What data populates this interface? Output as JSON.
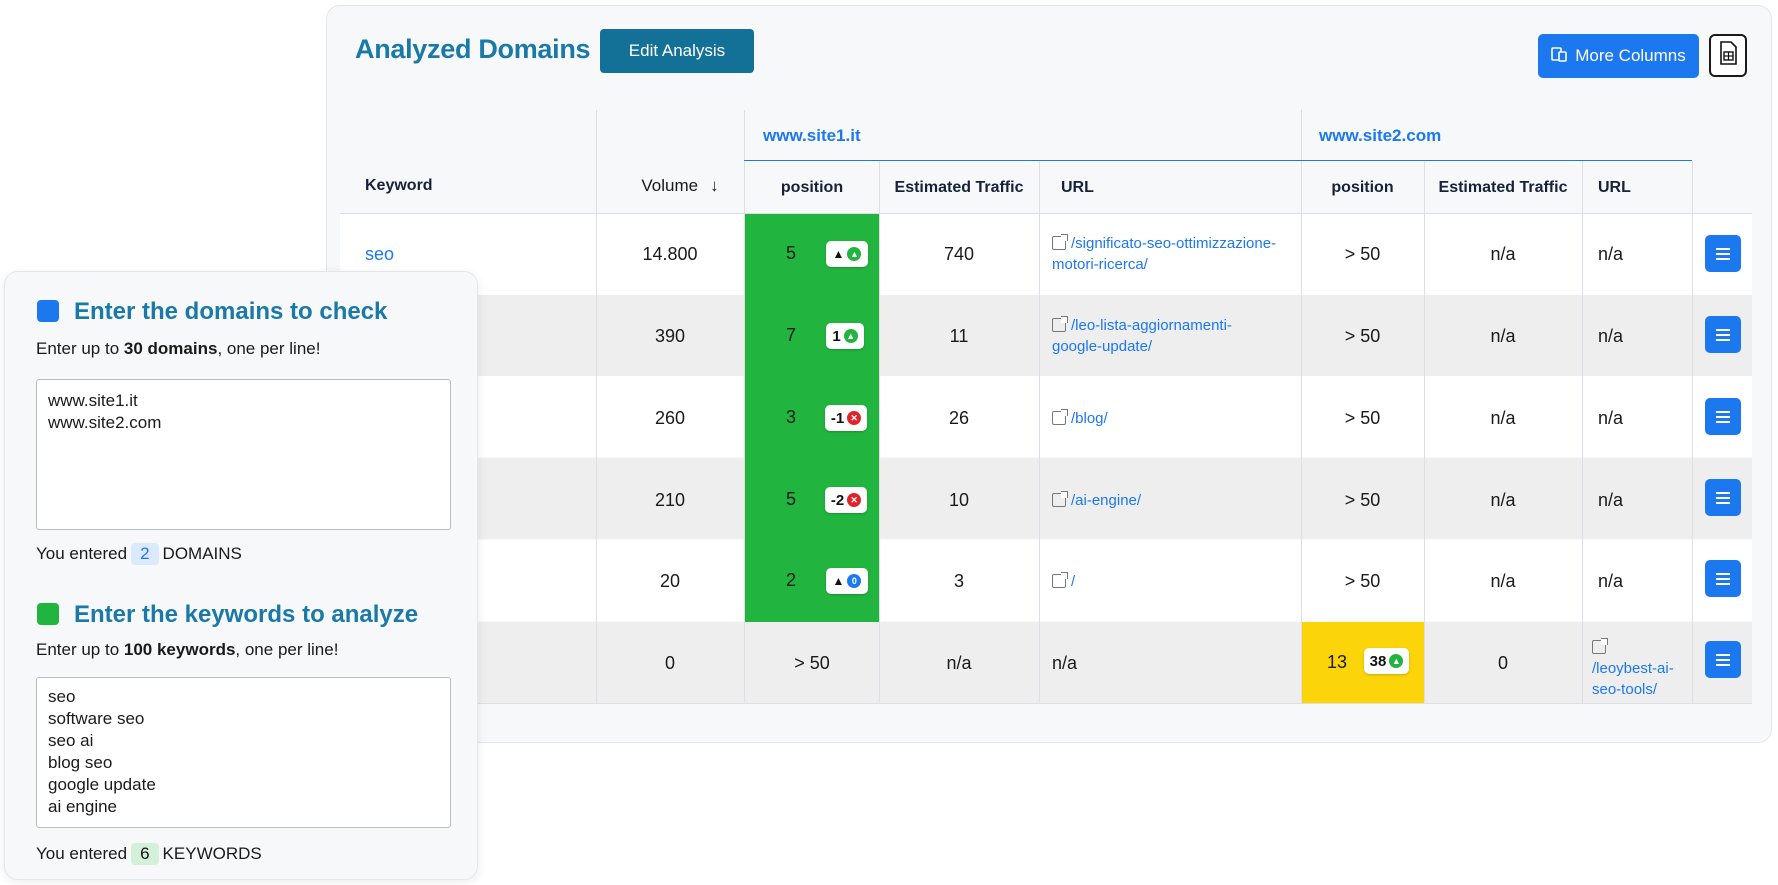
{
  "header": {
    "title": "Analyzed Domains",
    "edit_label": "Edit Analysis",
    "more_columns_label": "More Columns",
    "export_icon": "export-file-icon"
  },
  "table": {
    "keyword_header": "Keyword",
    "volume_header": "Volume",
    "sites": [
      "www.site1.it",
      "www.site2.com"
    ],
    "sub_headers": [
      "position",
      "Estimated Traffic",
      "URL"
    ],
    "rows": [
      {
        "keyword": "seo",
        "volume": "14.800",
        "s1_pos": "5",
        "s1_badge": "",
        "s1_badge_kind": "up-green",
        "s1_traffic": "740",
        "s1_url": "/significato-seo-ottimizzazione-motori-ricerca/",
        "s2_pos": "> 50",
        "s2_badge": "",
        "s2_traffic": "n/a",
        "s2_url": "n/a"
      },
      {
        "keyword": "",
        "volume": "390",
        "s1_pos": "7",
        "s1_badge": "1",
        "s1_badge_kind": "green",
        "s1_traffic": "11",
        "s1_url": "/leo-lista-aggiornamenti-google-update/",
        "s2_pos": "> 50",
        "s2_badge": "",
        "s2_traffic": "n/a",
        "s2_url": "n/a"
      },
      {
        "keyword": "",
        "volume": "260",
        "s1_pos": "3",
        "s1_badge": "-1",
        "s1_badge_kind": "red",
        "s1_traffic": "26",
        "s1_url": "/blog/",
        "s2_pos": "> 50",
        "s2_badge": "",
        "s2_traffic": "n/a",
        "s2_url": "n/a"
      },
      {
        "keyword": "",
        "volume": "210",
        "s1_pos": "5",
        "s1_badge": "-2",
        "s1_badge_kind": "red",
        "s1_traffic": "10",
        "s1_url": "/ai-engine/",
        "s2_pos": "> 50",
        "s2_badge": "",
        "s2_traffic": "n/a",
        "s2_url": "n/a"
      },
      {
        "keyword": "",
        "volume": "20",
        "s1_pos": "2",
        "s1_badge": "",
        "s1_badge_kind": "up-blue",
        "s1_traffic": "3",
        "s1_url": "/",
        "s2_pos": "> 50",
        "s2_badge": "",
        "s2_traffic": "n/a",
        "s2_url": "n/a"
      },
      {
        "keyword": "",
        "volume": "0",
        "s1_pos": "> 50",
        "s1_badge": "",
        "s1_badge_kind": "none",
        "s1_traffic": "n/a",
        "s1_url": "n/a",
        "s2_pos": "13",
        "s2_badge": "38",
        "s2_traffic": "0",
        "s2_url": "/leoybest-ai-seo-tools/"
      }
    ]
  },
  "panel": {
    "domains_title": "Enter the domains to check",
    "domains_hint_pre": "Enter up to ",
    "domains_hint_bold": "30 domains",
    "domains_hint_post": ", one per line!",
    "domains_value": "www.site1.it\nwww.site2.com",
    "domains_count_pre": "You entered",
    "domains_count": "2",
    "domains_count_post": "DOMAINS",
    "keywords_title": "Enter the keywords to analyze",
    "keywords_hint_pre": "Enter up to ",
    "keywords_hint_bold": "100 keywords",
    "keywords_hint_post": ", one per line!",
    "keywords_value": "seo\nsoftware seo\nseo ai\nblog seo\ngoogle update\nai engine",
    "keywords_count_pre": "You entered",
    "keywords_count": "6",
    "keywords_count_post": "KEYWORDS"
  },
  "colors": {
    "accent_blue": "#1c78ee",
    "title_teal": "#1b79a8",
    "edit_teal": "#137197",
    "good_green": "#21b53f",
    "warn_yellow": "#fbd40a",
    "down_red": "#e0242c"
  }
}
